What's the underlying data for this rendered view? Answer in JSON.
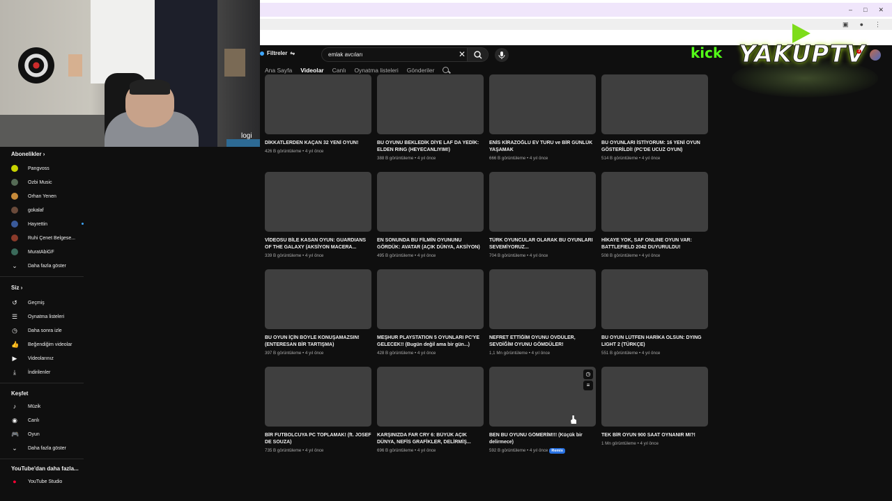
{
  "webcam": {
    "brand": "logi"
  },
  "browser": {
    "controls": [
      "–",
      "□",
      "✕"
    ]
  },
  "overlay": {
    "kick_text": "kick",
    "logo_text": "YAKUPTV",
    "badge": "3"
  },
  "header": {
    "filters_label": "Filtreler",
    "search_value": "emlak avcıları"
  },
  "tabs": [
    "Ana Sayfa",
    "Videolar",
    "Canlı",
    "Oynatma listeleri",
    "Gönderiler"
  ],
  "sidebar": {
    "subs_heading": "Abonelikler",
    "subscriptions": [
      "Pangvoss",
      "Ozbi Music",
      "Orhan Yenen",
      "gokalaf",
      "Hayrettin",
      "Ruhi Çenet Belgese...",
      "MuratAbiGF"
    ],
    "show_more": "Daha fazla göster",
    "you_heading": "Siz",
    "you_items": [
      "Geçmiş",
      "Oynatma listeleri",
      "Daha sonra izle",
      "Beğendiğim videolar",
      "Videolarınız",
      "İndirilenler"
    ],
    "explore_heading": "Keşfet",
    "explore_items": [
      "Müzik",
      "Canlı",
      "Oyun"
    ],
    "explore_more": "Daha fazla göster",
    "more_heading": "YouTube'dan daha fazla...",
    "more_items": [
      "YouTube Studio"
    ]
  },
  "videos": [
    {
      "title": "DİKKATLERDEN KAÇAN 32 YENİ OYUN!",
      "meta": "426 B görüntüleme • 4 yıl önce"
    },
    {
      "title": "BU OYUNU BEKLEDİK DİYE LAF DA YEDİK: ELDEN RING (HEYECANLIYIM!)",
      "meta": "388 B görüntüleme • 4 yıl önce"
    },
    {
      "title": "ENİS KİRAZOĞLU EV TURU ve BİR GÜNLÜK YAŞAMAK",
      "meta": "666 B görüntüleme • 4 yıl önce"
    },
    {
      "title": "BU OYUNLARI İSTİYORUM: 16 YENİ OYUN GÖSTERİLDİ! (PC'DE UCUZ OYUN)",
      "meta": "514 B görüntüleme • 4 yıl önce"
    },
    {
      "title": "VİDEOSU BİLE KASAN OYUN: GUARDIANS OF THE GALAXY (AKSİYON MACERA...",
      "meta": "339 B görüntüleme • 4 yıl önce"
    },
    {
      "title": "EN SONUNDA BU FİLMİN OYUNUNU GÖRDÜK: AVATAR (AÇIK DÜNYA, AKSİYON)",
      "meta": "495 B görüntüleme • 4 yıl önce"
    },
    {
      "title": "TÜRK OYUNCULAR OLARAK BU OYUNLARI SEVEMİYORUZ...",
      "meta": "704 B görüntüleme • 4 yıl önce"
    },
    {
      "title": "HİKAYE YOK, SAF ONLINE OYUN VAR: BATTLEFIELD 2042 DUYURULDU!",
      "meta": "508 B görüntüleme • 4 yıl önce"
    },
    {
      "title": "BU OYUN İÇİN BÖYLE KONUŞAMAZSIN! (ENTERESAN BİR TARTIŞMA)",
      "meta": "397 B görüntüleme • 4 yıl önce"
    },
    {
      "title": "MEŞHUR PLAYSTATION 5 OYUNLARI PC'YE GELECEK!! (Bugün değil ama bir gün...)",
      "meta": "428 B görüntüleme • 4 yıl önce"
    },
    {
      "title": "NEFRET ETTİĞİM OYUNU ÖVDÜLER, SEVDİĞİM OYUNU GÖMDÜLER!",
      "meta": "1,1 Mn görüntüleme • 4 yıl önce"
    },
    {
      "title": "BU OYUN LÜTFEN HARİKA OLSUN: DYING LIGHT 2 (TÜRKÇE)",
      "meta": "551 B görüntüleme • 4 yıl önce"
    },
    {
      "title": "BİR FUTBOLCUYA PC TOPLAMAK! (ft. JOSEF DE SOUZA)",
      "meta": "735 B görüntüleme • 4 yıl önce"
    },
    {
      "title": "KARŞINIZDA FAR CRY 6: BÜYÜK AÇIK DÜNYA, NEFİS GRAFİKLER, DELİRMİŞ...",
      "meta": "696 B görüntüleme • 4 yıl önce"
    },
    {
      "title": "BEN BU OYUNU GÖMERİM!!! (Küçük bir delirmece)",
      "meta": "592 B görüntüleme • 4 yıl önce",
      "badge": "Remix"
    },
    {
      "title": "TEK BİR OYUN 900 SAAT OYNANIR MI?!",
      "meta": "1 Mn görüntüleme • 4 yıl önce"
    }
  ]
}
